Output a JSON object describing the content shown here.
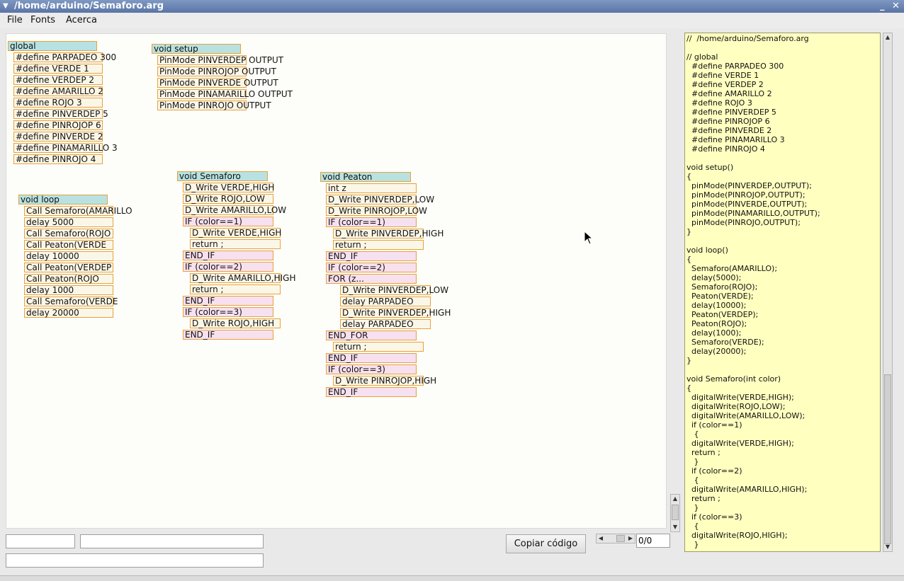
{
  "window": {
    "title": "/home/arduino/Semaforo.arg",
    "minimize": "_",
    "close": "✕"
  },
  "menu": {
    "file": "File",
    "fonts": "Fonts",
    "about": "Acerca"
  },
  "blocks": {
    "global": [
      "global",
      "#define PARPADEO 300",
      "#define VERDE 1",
      "#define VERDEP 2",
      "#define AMARILLO 2",
      "#define ROJO 3",
      "#define PINVERDEP 5",
      "#define PINROJOP 6",
      "#define PINVERDE 2",
      "#define PINAMARILLO 3",
      "#define PINROJO 4"
    ],
    "setup": [
      "void setup",
      "PinMode PINVERDEP OUTPUT",
      "PinMode PINROJOP OUTPUT",
      "PinMode PINVERDE OUTPUT",
      "PinMode PINAMARILLO OUTPUT",
      "PinMode PINROJO OUTPUT"
    ],
    "loop": [
      "void loop",
      "Call Semaforo(AMARILLO",
      "delay 5000",
      "Call Semaforo(ROJO",
      "Call Peaton(VERDE",
      "delay 10000",
      "Call Peaton(VERDEP",
      "Call Peaton(ROJO",
      "delay 1000",
      "Call Semaforo(VERDE",
      "delay 20000"
    ],
    "semaforo": [
      "void Semaforo",
      "D_Write VERDE,HIGH",
      "D_Write ROJO,LOW",
      "D_Write AMARILLO,LOW",
      "IF (color==1)",
      "D_Write VERDE,HIGH",
      "return ;",
      "END_IF",
      "IF (color==2)",
      "D_Write AMARILLO,HIGH",
      "return ;",
      "END_IF",
      "IF (color==3)",
      "D_Write ROJO,HIGH",
      "END_IF"
    ],
    "peaton": [
      "void Peaton",
      "int z",
      "D_Write PINVERDEP,LOW",
      "D_Write PINROJOP,LOW",
      "IF (color==1)",
      "D_Write PINVERDEP,HIGH",
      "return ;",
      "END_IF",
      "IF (color==2)",
      "FOR (z...",
      "D_Write PINVERDEP,LOW",
      "delay PARPADEO",
      "D_Write PINVERDEP,HIGH",
      "delay PARPADEO",
      "END_FOR",
      "return ;",
      "END_IF",
      "IF (color==3)",
      "D_Write PINROJOP,HIGH",
      "END_IF"
    ]
  },
  "code": "//  /home/arduino/Semaforo.arg\n\n// global\n  #define PARPADEO 300\n  #define VERDE 1\n  #define VERDEP 2\n  #define AMARILLO 2\n  #define ROJO 3\n  #define PINVERDEP 5\n  #define PINROJOP 6\n  #define PINVERDE 2\n  #define PINAMARILLO 3\n  #define PINROJO 4\n\nvoid setup()\n{\n  pinMode(PINVERDEP,OUTPUT);\n  pinMode(PINROJOP,OUTPUT);\n  pinMode(PINVERDE,OUTPUT);\n  pinMode(PINAMARILLO,OUTPUT);\n  pinMode(PINROJO,OUTPUT);\n}\n\nvoid loop()\n{\n  Semaforo(AMARILLO);\n  delay(5000);\n  Semaforo(ROJO);\n  Peaton(VERDE);\n  delay(10000);\n  Peaton(VERDEP);\n  Peaton(ROJO);\n  delay(1000);\n  Semaforo(VERDE);\n  delay(20000);\n}\n\nvoid Semaforo(int color)\n{\n  digitalWrite(VERDE,HIGH);\n  digitalWrite(ROJO,LOW);\n  digitalWrite(AMARILLO,LOW);\n  if (color==1)\n   {\n  digitalWrite(VERDE,HIGH);\n  return ;\n   }\n  if (color==2)\n   {\n  digitalWrite(AMARILLO,HIGH);\n  return ;\n   }\n  if (color==3)\n   {\n  digitalWrite(ROJO,HIGH);\n   }",
  "controls": {
    "copy_button": "Copiar código",
    "pager": "0/0",
    "field1": "",
    "field2": "",
    "field3": ""
  },
  "icons": {
    "window_menu": "triangle-down-icon",
    "cursor": "mouse-pointer-icon"
  }
}
